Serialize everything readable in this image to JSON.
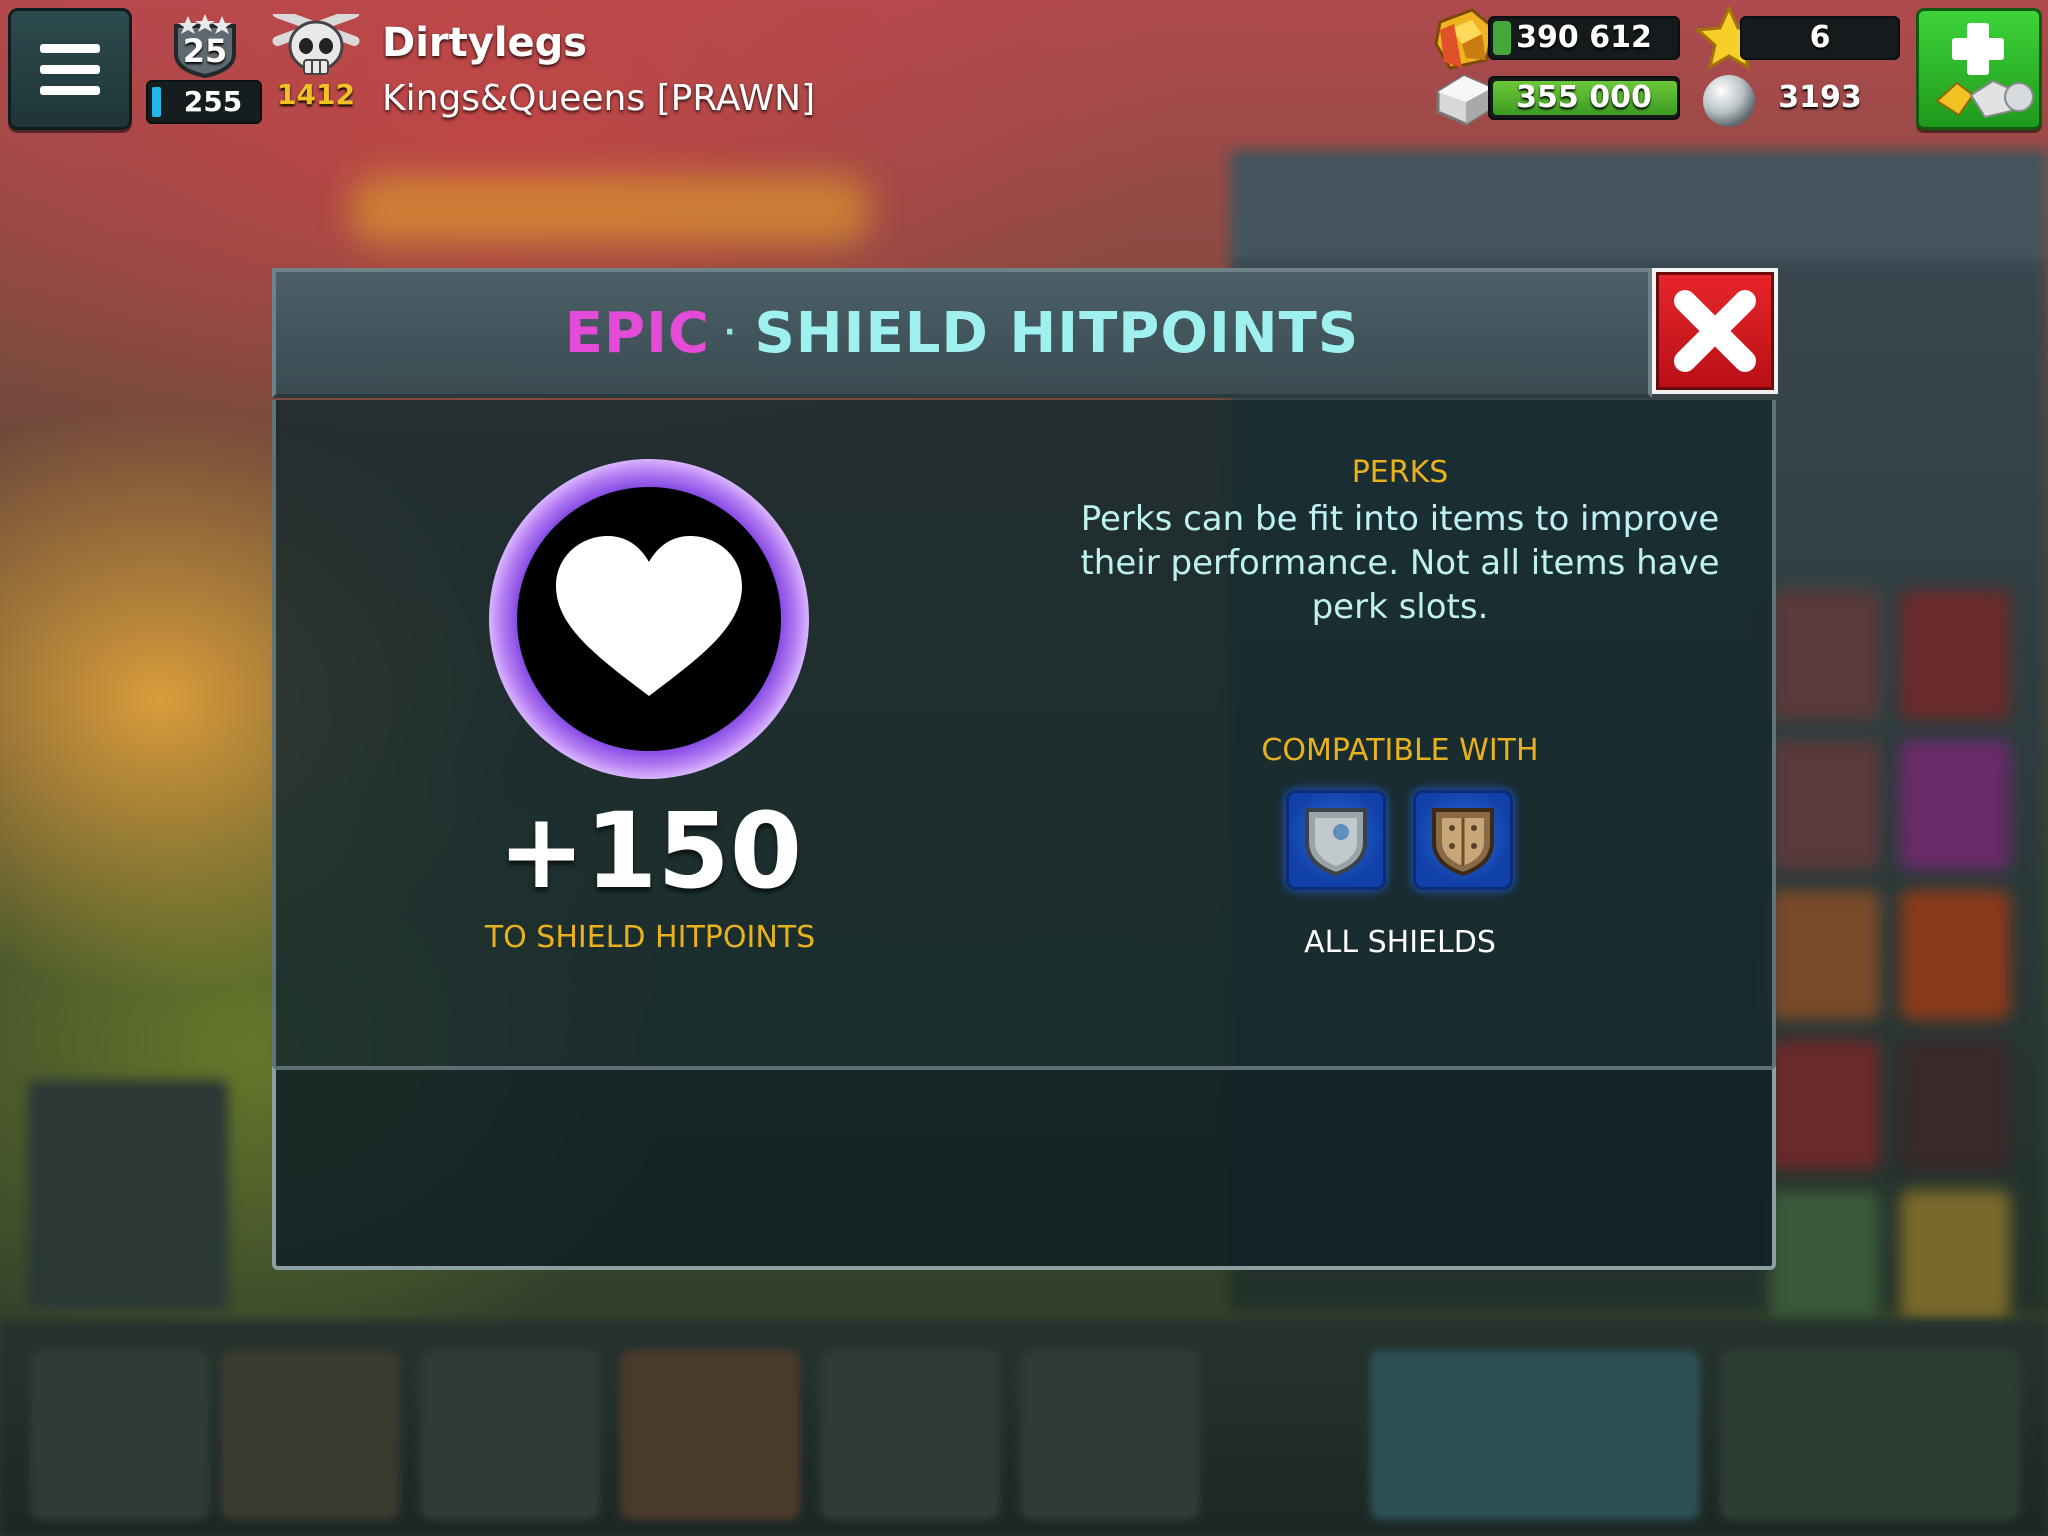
{
  "hud": {
    "menu_icon": "hamburger-menu-icon",
    "level": "25",
    "xp": "255",
    "xp_fill_fraction": 0.08,
    "trophies": "1412",
    "player_name": "Dirtylegs",
    "clan": "Kings&Queens [PRAWN]",
    "gold": "390 612",
    "gold_fill_fraction": 0.1,
    "silver": "355 000",
    "silver_fill_fraction": 1.0,
    "stars": "6",
    "pearls": "3193",
    "shop_icon": "add-currency-icon"
  },
  "modal": {
    "rarity": "EPIC",
    "separator": "·",
    "title": "SHIELD HITPOINTS",
    "rarity_color": "#e44bd8",
    "title_color": "#9ff1ef",
    "close_icon": "close-x-icon",
    "perk_icon": "heart-icon",
    "bonus_value": "+150",
    "bonus_label": "TO SHIELD HITPOINTS",
    "perks_heading": "PERKS",
    "perks_description": "Perks can be fit into items to improve their performance. Not all items have perk slots.",
    "compatible_heading": "COMPATIBLE WITH",
    "compatible_items": [
      {
        "icon": "steel-shield-icon"
      },
      {
        "icon": "wooden-shield-icon"
      }
    ],
    "compatible_label": "ALL SHIELDS"
  }
}
